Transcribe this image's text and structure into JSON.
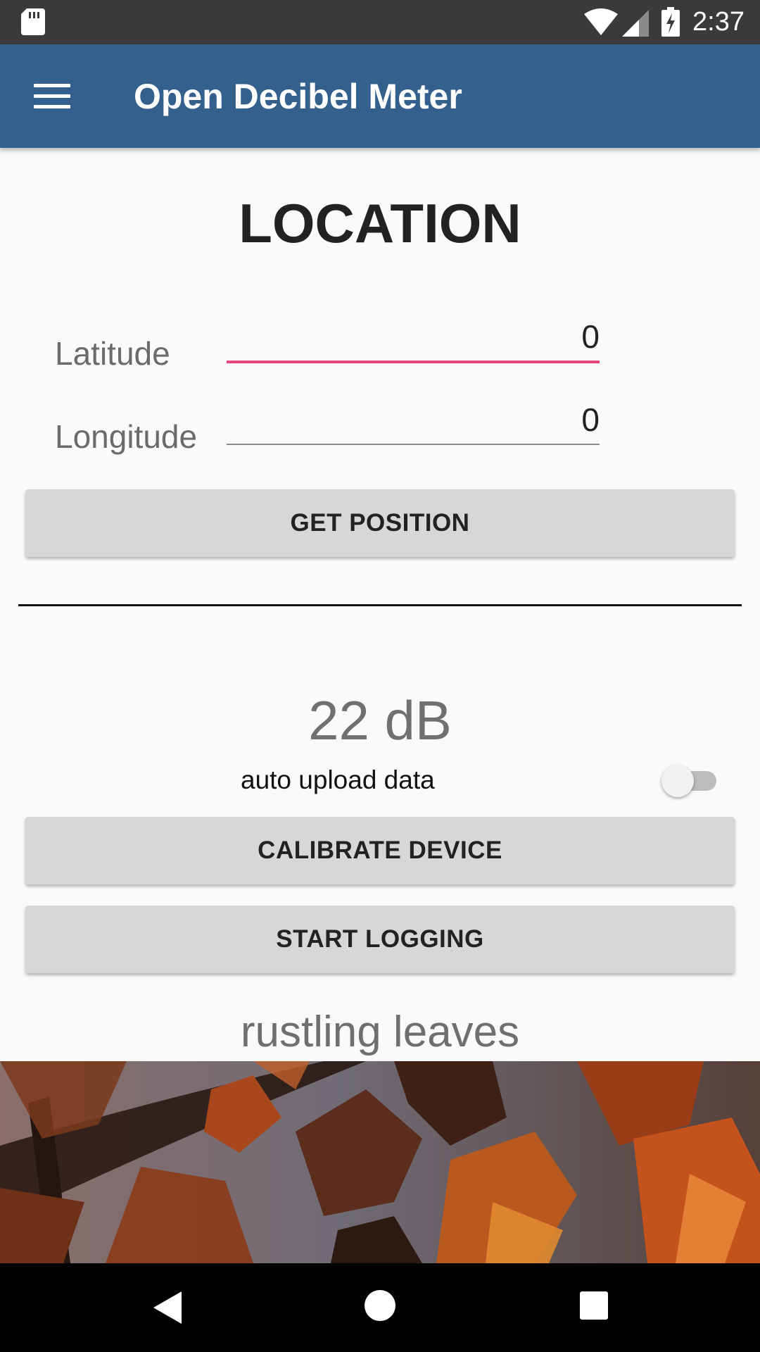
{
  "status_bar": {
    "time": "2:37",
    "icons": [
      "sd-card-icon",
      "wifi-icon",
      "signal-icon",
      "battery-charging-icon"
    ]
  },
  "app_bar": {
    "title": "Open Decibel Meter",
    "menu_icon": "menu-icon"
  },
  "location": {
    "title": "LOCATION",
    "latitude": {
      "label": "Latitude",
      "value": "0"
    },
    "longitude": {
      "label": "Longitude",
      "value": "0"
    },
    "get_position_label": "GET POSITION"
  },
  "meter": {
    "reading": "22 dB",
    "auto_upload_label": "auto upload data",
    "auto_upload_enabled": false,
    "calibrate_label": "CALIBRATE DEVICE",
    "start_logging_label": "START LOGGING"
  },
  "sound_reference": {
    "label": "rustling leaves",
    "image": "autumn-leaves-photo"
  },
  "colors": {
    "app_bar": "#34608d",
    "accent": "#e8457c",
    "button": "#d6d7d7"
  },
  "nav_bar": {
    "icons": [
      "back-icon",
      "home-icon",
      "recent-apps-icon"
    ]
  }
}
